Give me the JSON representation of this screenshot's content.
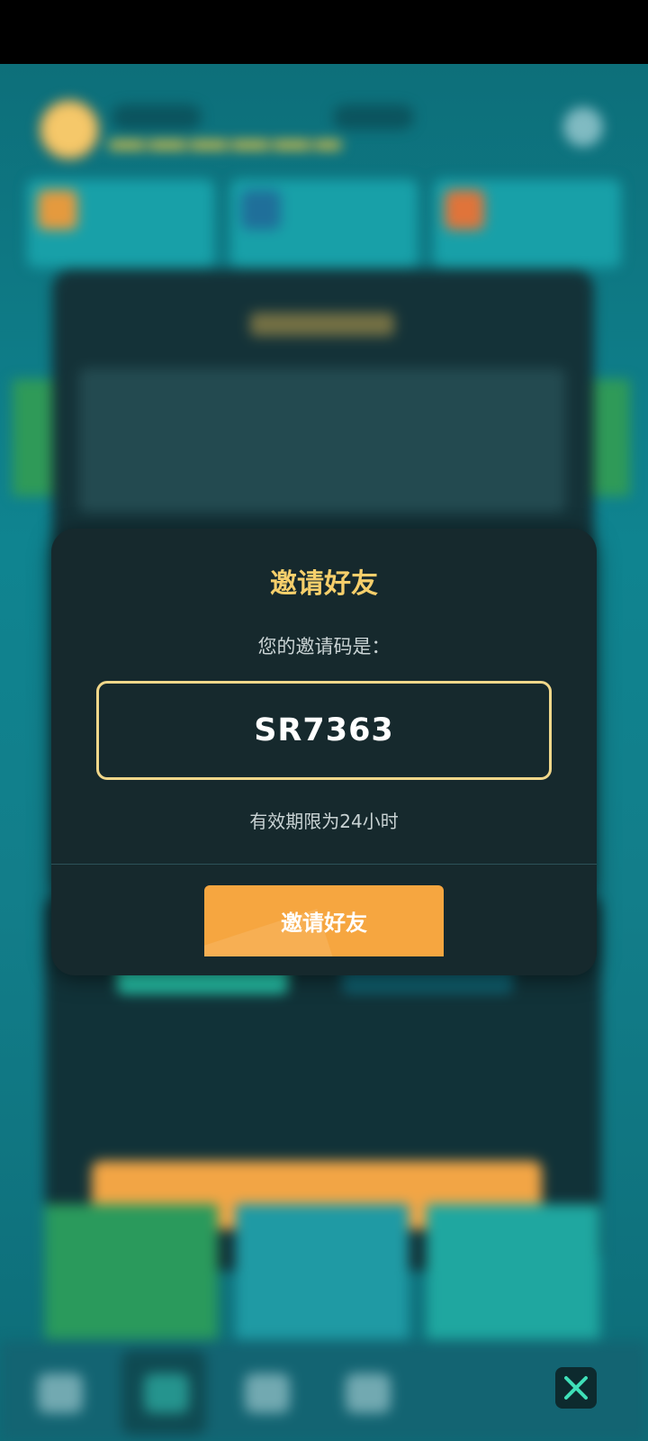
{
  "invite_modal": {
    "title": "邀请好友",
    "subtitle": "您的邀请码是：",
    "code": "SR7363",
    "validity": "有效期限为24小时",
    "button_label": "邀请好友"
  },
  "colors": {
    "title_accent": "#f6cf6b",
    "button": "#f6a640",
    "modal_background": "#16292d",
    "close_button_icon": "#3fe0b8"
  },
  "background_nav": {
    "icons": [
      "warning-icon",
      "shield-icon",
      "compass-icon",
      "heart-icon"
    ],
    "close_icon": "close-icon"
  }
}
